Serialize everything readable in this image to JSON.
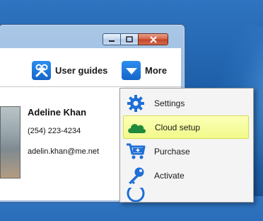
{
  "toolbar": {
    "user_guides_label": "User guides",
    "more_label": "More",
    "user_guides_icon": "tools-icon",
    "more_icon": "chevron-down-icon"
  },
  "contact": {
    "name": "Adeline Khan",
    "phone": "(254) 223-4234",
    "email": "adelin.khan@me.net"
  },
  "menu": {
    "items": [
      {
        "label": "Settings",
        "icon": "gear-icon",
        "highlighted": false
      },
      {
        "label": "Cloud setup",
        "icon": "cloud-icon",
        "highlighted": true
      },
      {
        "label": "Purchase",
        "icon": "cart-icon",
        "highlighted": false
      },
      {
        "label": "Activate",
        "icon": "key-icon",
        "highlighted": false
      }
    ]
  },
  "colors": {
    "accent_blue": "#1e78e0",
    "highlight": "#f1f98b",
    "cloud_green": "#1f8a3c"
  }
}
